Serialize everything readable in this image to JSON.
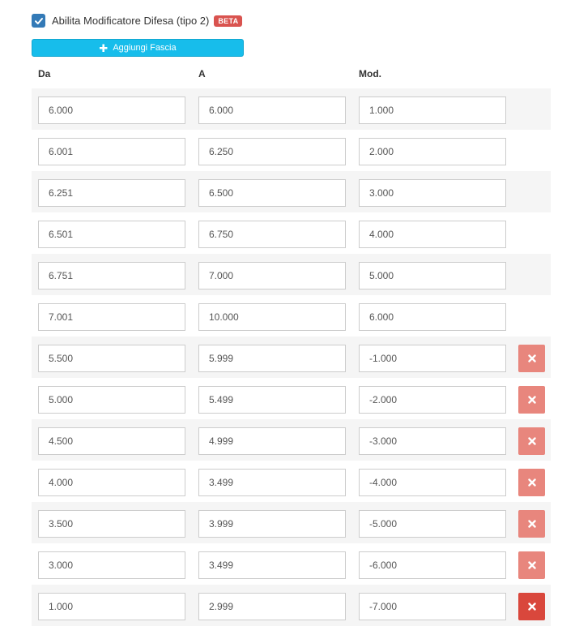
{
  "toggle": {
    "label": "Abilita Modificatore Difesa (tipo 2)",
    "badge": "BETA",
    "checked": true
  },
  "add_button": {
    "label": "Aggiungi Fascia",
    "icon": "plus-icon"
  },
  "columns": {
    "from": "Da",
    "to": "A",
    "mod": "Mod."
  },
  "rows": [
    {
      "from": "6.000",
      "to": "6.000",
      "mod": "1.000",
      "deletable": false
    },
    {
      "from": "6.001",
      "to": "6.250",
      "mod": "2.000",
      "deletable": false
    },
    {
      "from": "6.251",
      "to": "6.500",
      "mod": "3.000",
      "deletable": false
    },
    {
      "from": "6.501",
      "to": "6.750",
      "mod": "4.000",
      "deletable": false
    },
    {
      "from": "6.751",
      "to": "7.000",
      "mod": "5.000",
      "deletable": false
    },
    {
      "from": "7.001",
      "to": "10.000",
      "mod": "6.000",
      "deletable": false
    },
    {
      "from": "5.500",
      "to": "5.999",
      "mod": "-1.000",
      "deletable": true
    },
    {
      "from": "5.000",
      "to": "5.499",
      "mod": "-2.000",
      "deletable": true
    },
    {
      "from": "4.500",
      "to": "4.999",
      "mod": "-3.000",
      "deletable": true
    },
    {
      "from": "4.000",
      "to": "3.499",
      "mod": "-4.000",
      "deletable": true
    },
    {
      "from": "3.500",
      "to": "3.999",
      "mod": "-5.000",
      "deletable": true
    },
    {
      "from": "3.000",
      "to": "3.499",
      "mod": "-6.000",
      "deletable": true
    },
    {
      "from": "1.000",
      "to": "2.999",
      "mod": "-7.000",
      "deletable": true,
      "hovered": true
    }
  ],
  "colors": {
    "accent": "#17bdeb",
    "checkbox": "#337ab7",
    "badge": "#d9534f",
    "delete": "#e8867d",
    "delete_active": "#d9473c"
  }
}
